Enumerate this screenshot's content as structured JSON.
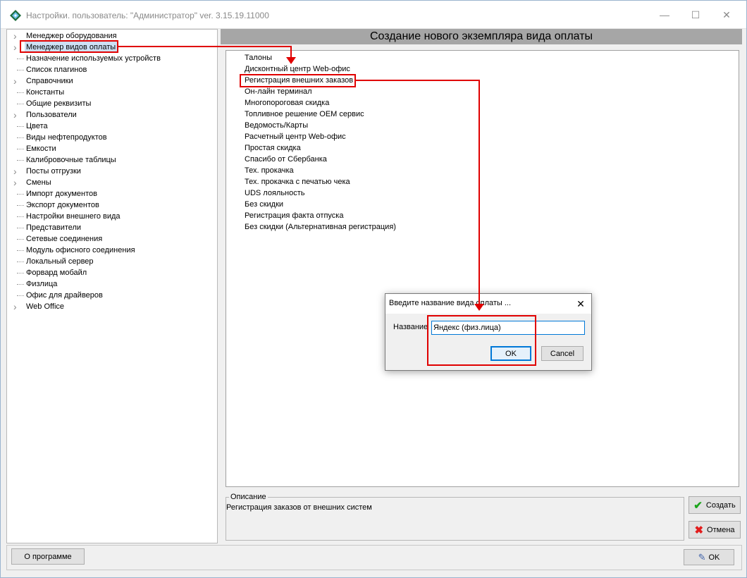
{
  "window": {
    "title": "Настройки. пользователь: \"Администратор\" ver. 3.15.19.11000",
    "minimize_glyph": "—",
    "maximize_glyph": "☐",
    "close_glyph": "✕"
  },
  "tree": {
    "items": [
      {
        "label": "Менеджер оборудования",
        "expandable": true
      },
      {
        "label": "Менеджер видов оплаты",
        "expandable": true,
        "selected": true
      },
      {
        "label": "Назначение используемых устройств",
        "expandable": false
      },
      {
        "label": "Список плагинов",
        "expandable": false
      },
      {
        "label": "Справочники",
        "expandable": true
      },
      {
        "label": "Константы",
        "expandable": false
      },
      {
        "label": "Общие реквизиты",
        "expandable": false
      },
      {
        "label": "Пользователи",
        "expandable": true
      },
      {
        "label": "Цвета",
        "expandable": false
      },
      {
        "label": "Виды нефтепродуктов",
        "expandable": false
      },
      {
        "label": "Емкости",
        "expandable": false
      },
      {
        "label": "Калибровочные таблицы",
        "expandable": false
      },
      {
        "label": "Посты отгрузки",
        "expandable": true
      },
      {
        "label": "Смены",
        "expandable": true
      },
      {
        "label": "Импорт документов",
        "expandable": false
      },
      {
        "label": "Экспорт документов",
        "expandable": false
      },
      {
        "label": "Настройки внешнего вида",
        "expandable": false
      },
      {
        "label": "Представители",
        "expandable": false
      },
      {
        "label": "Сетевые соединения",
        "expandable": false
      },
      {
        "label": "Модуль офисного соединения",
        "expandable": false
      },
      {
        "label": "Локальный сервер",
        "expandable": false
      },
      {
        "label": "Форвард мобайл",
        "expandable": false
      },
      {
        "label": "Физлица",
        "expandable": false
      },
      {
        "label": "Офис для драйверов",
        "expandable": false
      },
      {
        "label": "Web Office",
        "expandable": true
      }
    ]
  },
  "main": {
    "header": "Создание нового экземпляра вида оплаты",
    "payment_types": [
      "Талоны",
      "Дисконтный центр Web-офис",
      "Регистрация внешних заказов",
      "Он-лайн терминал",
      "Многопороговая скидка",
      "Топливное решение OEM сервис",
      "Ведомость/Карты",
      "Расчетный центр Web-офис",
      "Простая скидка",
      "Спасибо от Сбербанка",
      "Тех. прокачка",
      "Тех. прокачка с печатью чека",
      "UDS лояльность",
      "Без скидки",
      "Регистрация факта отпуска",
      "Без скидки (Альтернативная регистрация)"
    ],
    "selected_index": 2,
    "description_legend": "Описание",
    "description_text": "Регистрация заказов от внешних систем",
    "create_label": "Создать",
    "cancel_label": "Отмена"
  },
  "footer": {
    "about_label": "О программе",
    "ok_label": "OK"
  },
  "dialog": {
    "title": "Введите название вида оплаты ...",
    "close_glyph": "✕",
    "name_label": "Название",
    "name_value": "Яндекс (физ.лица)",
    "ok_label": "OK",
    "cancel_label": "Cancel"
  },
  "colors": {
    "annotation": "#e00000",
    "header_bar": "#a6a6a6",
    "selection": "#cde0f5",
    "focus": "#0078d7"
  }
}
